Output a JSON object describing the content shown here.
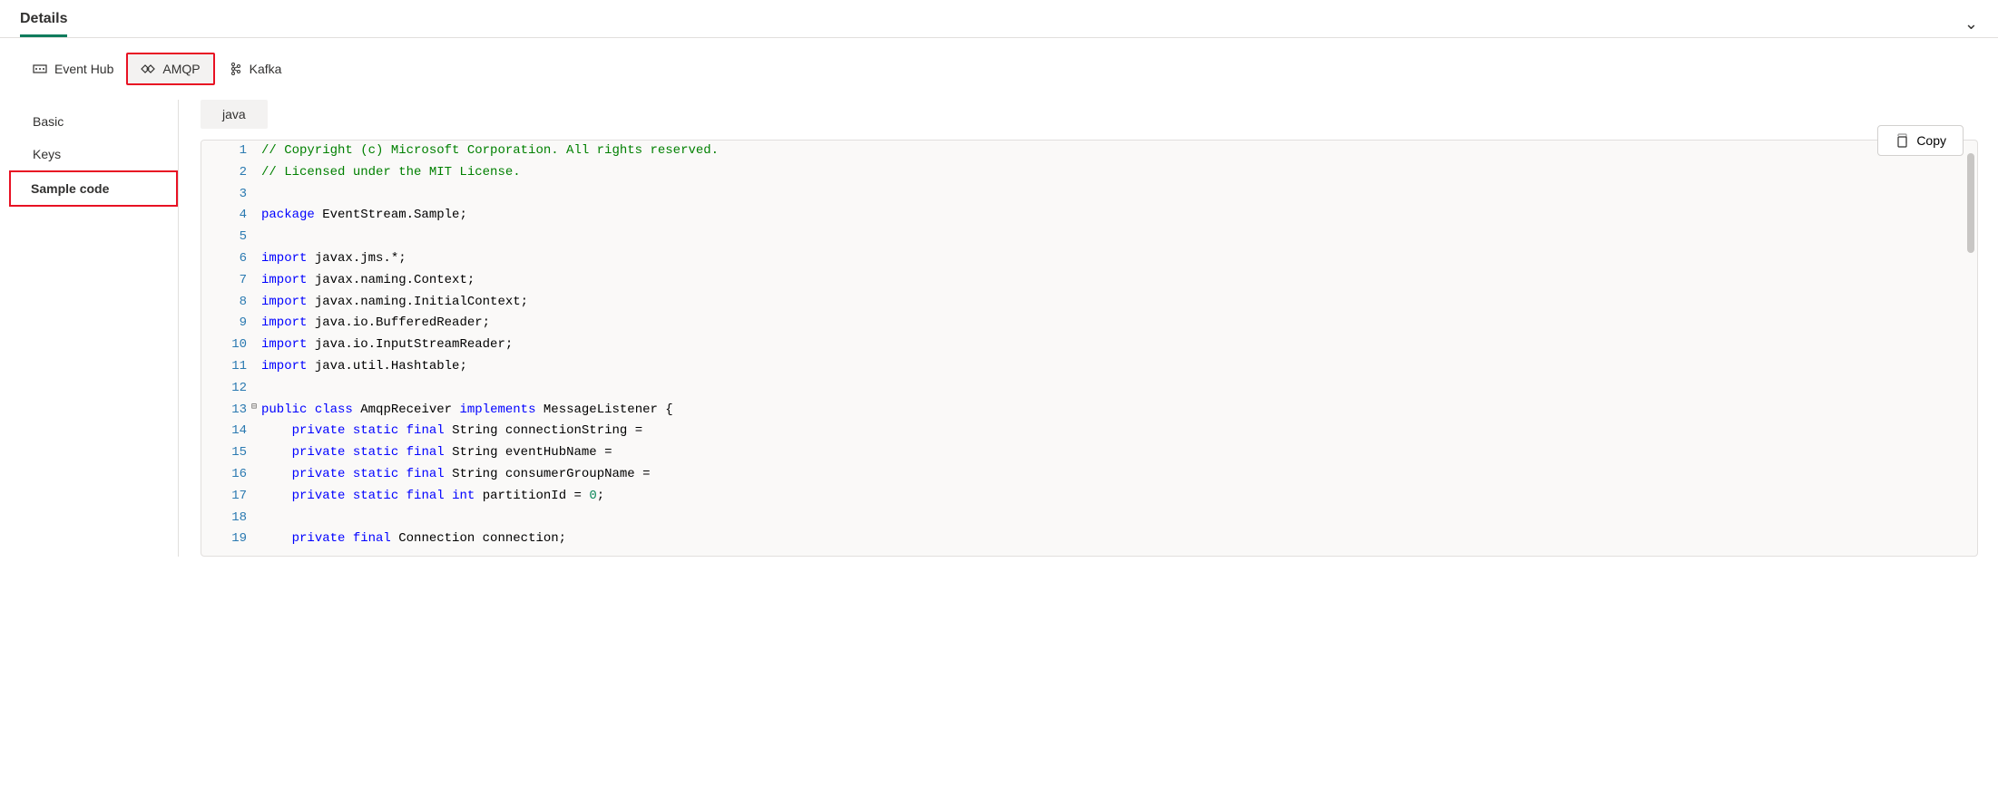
{
  "header": {
    "title": "Details"
  },
  "protocolTabs": {
    "items": [
      {
        "label": "Event Hub"
      },
      {
        "label": "AMQP"
      },
      {
        "label": "Kafka"
      }
    ]
  },
  "sidebar": {
    "items": [
      {
        "label": "Basic"
      },
      {
        "label": "Keys"
      },
      {
        "label": "Sample code"
      }
    ]
  },
  "main": {
    "language_tab": "java",
    "copy_label": "Copy"
  },
  "code": {
    "lines": [
      {
        "n": 1,
        "fold": "",
        "tokens": [
          [
            "comment",
            "// Copyright (c) Microsoft Corporation. All rights reserved."
          ]
        ]
      },
      {
        "n": 2,
        "fold": "",
        "tokens": [
          [
            "comment",
            "// Licensed under the MIT License."
          ]
        ]
      },
      {
        "n": 3,
        "fold": "",
        "tokens": []
      },
      {
        "n": 4,
        "fold": "",
        "tokens": [
          [
            "keyword",
            "package"
          ],
          [
            "plain",
            " EventStream.Sample;"
          ]
        ]
      },
      {
        "n": 5,
        "fold": "",
        "tokens": []
      },
      {
        "n": 6,
        "fold": "",
        "tokens": [
          [
            "keyword",
            "import"
          ],
          [
            "plain",
            " javax.jms.*;"
          ]
        ]
      },
      {
        "n": 7,
        "fold": "",
        "tokens": [
          [
            "keyword",
            "import"
          ],
          [
            "plain",
            " javax.naming.Context;"
          ]
        ]
      },
      {
        "n": 8,
        "fold": "",
        "tokens": [
          [
            "keyword",
            "import"
          ],
          [
            "plain",
            " javax.naming.InitialContext;"
          ]
        ]
      },
      {
        "n": 9,
        "fold": "",
        "tokens": [
          [
            "keyword",
            "import"
          ],
          [
            "plain",
            " java.io.BufferedReader;"
          ]
        ]
      },
      {
        "n": 10,
        "fold": "",
        "tokens": [
          [
            "keyword",
            "import"
          ],
          [
            "plain",
            " java.io.InputStreamReader;"
          ]
        ]
      },
      {
        "n": 11,
        "fold": "",
        "tokens": [
          [
            "keyword",
            "import"
          ],
          [
            "plain",
            " java.util.Hashtable;"
          ]
        ]
      },
      {
        "n": 12,
        "fold": "",
        "tokens": []
      },
      {
        "n": 13,
        "fold": "⊟",
        "tokens": [
          [
            "keyword",
            "public"
          ],
          [
            "plain",
            " "
          ],
          [
            "keyword",
            "class"
          ],
          [
            "plain",
            " AmqpReceiver "
          ],
          [
            "keyword",
            "implements"
          ],
          [
            "plain",
            " MessageListener {"
          ]
        ]
      },
      {
        "n": 14,
        "fold": "",
        "indent": "    ",
        "tokens": [
          [
            "keyword",
            "private"
          ],
          [
            "plain",
            " "
          ],
          [
            "keyword",
            "static"
          ],
          [
            "plain",
            " "
          ],
          [
            "keyword",
            "final"
          ],
          [
            "plain",
            " String connectionString ="
          ]
        ]
      },
      {
        "n": 15,
        "fold": "",
        "indent": "    ",
        "tokens": [
          [
            "keyword",
            "private"
          ],
          [
            "plain",
            " "
          ],
          [
            "keyword",
            "static"
          ],
          [
            "plain",
            " "
          ],
          [
            "keyword",
            "final"
          ],
          [
            "plain",
            " String eventHubName ="
          ]
        ]
      },
      {
        "n": 16,
        "fold": "",
        "indent": "    ",
        "tokens": [
          [
            "keyword",
            "private"
          ],
          [
            "plain",
            " "
          ],
          [
            "keyword",
            "static"
          ],
          [
            "plain",
            " "
          ],
          [
            "keyword",
            "final"
          ],
          [
            "plain",
            " String consumerGroupName ="
          ]
        ]
      },
      {
        "n": 17,
        "fold": "",
        "indent": "    ",
        "tokens": [
          [
            "keyword",
            "private"
          ],
          [
            "plain",
            " "
          ],
          [
            "keyword",
            "static"
          ],
          [
            "plain",
            " "
          ],
          [
            "keyword",
            "final"
          ],
          [
            "plain",
            " "
          ],
          [
            "keyword",
            "int"
          ],
          [
            "plain",
            " partitionId = "
          ],
          [
            "number",
            "0"
          ],
          [
            "plain",
            ";"
          ]
        ]
      },
      {
        "n": 18,
        "fold": "",
        "tokens": []
      },
      {
        "n": 19,
        "fold": "",
        "indent": "    ",
        "tokens": [
          [
            "keyword",
            "private"
          ],
          [
            "plain",
            " "
          ],
          [
            "keyword",
            "final"
          ],
          [
            "plain",
            " Connection connection;"
          ]
        ]
      }
    ]
  }
}
